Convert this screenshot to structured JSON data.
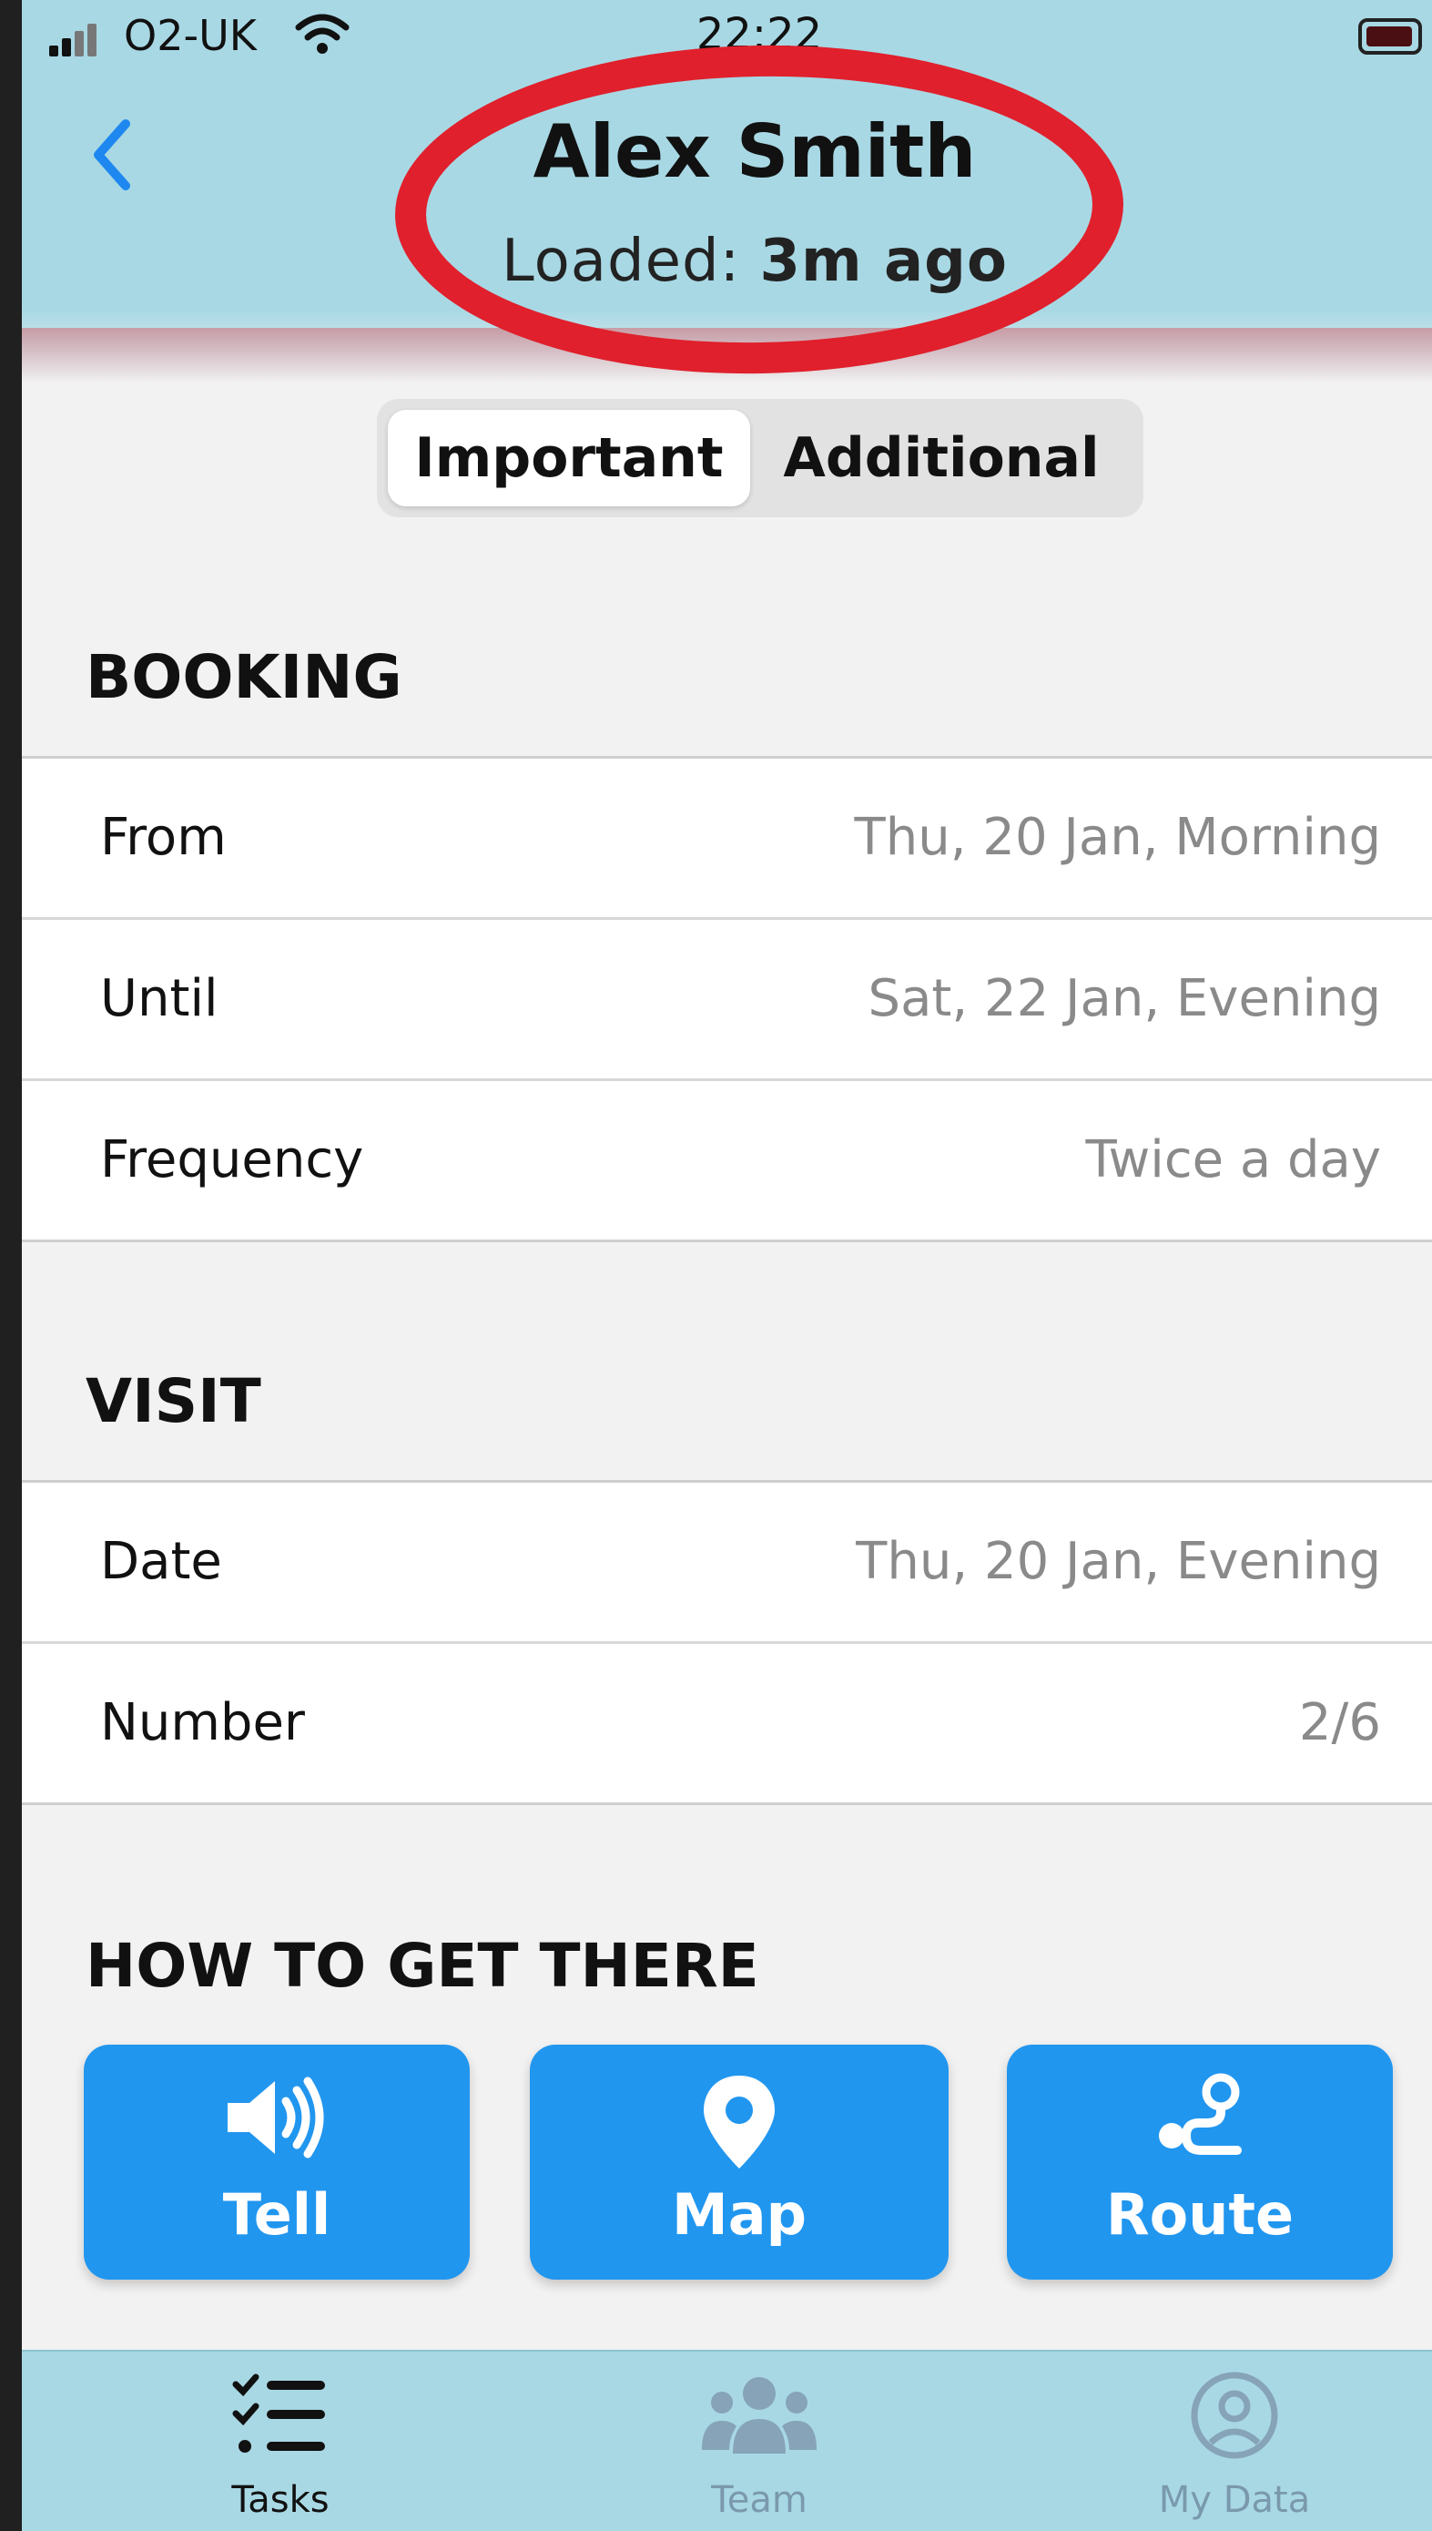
{
  "status_bar": {
    "carrier": "O2-UK",
    "time": "22:22"
  },
  "header": {
    "title": "Alex Smith",
    "loaded_label": "Loaded:",
    "loaded_value": "3m ago",
    "annotation_color": "#e0202c",
    "background_color": "#a8d8e4"
  },
  "segmented": {
    "options": [
      "Important",
      "Additional"
    ],
    "selected": "Important"
  },
  "booking": {
    "title": "BOOKING",
    "rows": [
      {
        "label": "From",
        "value": "Thu, 20 Jan, Morning"
      },
      {
        "label": "Until",
        "value": "Sat, 22 Jan, Evening"
      },
      {
        "label": "Frequency",
        "value": "Twice a day"
      }
    ]
  },
  "visit": {
    "title": "VISIT",
    "rows": [
      {
        "label": "Date",
        "value": "Thu, 20 Jan, Evening"
      },
      {
        "label": "Number",
        "value": "2/6"
      }
    ]
  },
  "directions": {
    "title": "HOW TO GET THERE",
    "buttons": [
      {
        "label": "Tell",
        "icon": "speaker-icon"
      },
      {
        "label": "Map",
        "icon": "map-pin-icon"
      },
      {
        "label": "Route",
        "icon": "route-icon"
      }
    ],
    "button_color": "#2196ef"
  },
  "tabbar": {
    "tabs": [
      {
        "label": "Tasks",
        "icon": "checklist-icon",
        "active": true
      },
      {
        "label": "Team",
        "icon": "team-icon",
        "active": false
      },
      {
        "label": "My Data",
        "icon": "user-circle-icon",
        "active": false
      }
    ]
  }
}
